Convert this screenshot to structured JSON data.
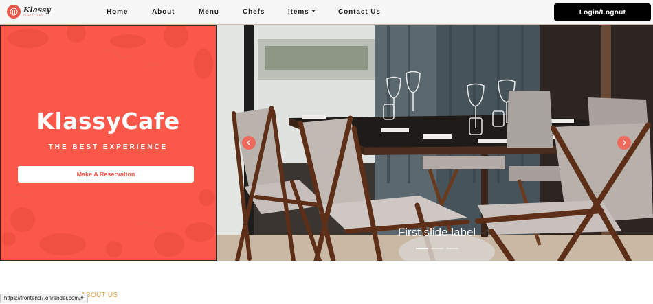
{
  "brand": {
    "name": "Klassy",
    "tagline": "SINCE 1985",
    "accent_color": "#fb5849"
  },
  "nav": {
    "links": [
      {
        "label": "Home"
      },
      {
        "label": "About"
      },
      {
        "label": "Menu"
      },
      {
        "label": "Chefs"
      },
      {
        "label": "Items",
        "has_dropdown": true
      },
      {
        "label": "Contact Us"
      }
    ],
    "login_label": "Login/Logout"
  },
  "hero": {
    "title": "KlassyCafe",
    "subtitle": "THE BEST EXPERIENCE",
    "reserve_label": "Make A Reservation"
  },
  "carousel": {
    "caption": "First slide label",
    "slide_count": 3,
    "active_index": 0,
    "prev_icon": "chevron-left-icon",
    "next_icon": "chevron-right-icon"
  },
  "about": {
    "heading": "ABOUT US"
  },
  "status_bar": {
    "url": "https://frontend7.onrender.com/#"
  }
}
